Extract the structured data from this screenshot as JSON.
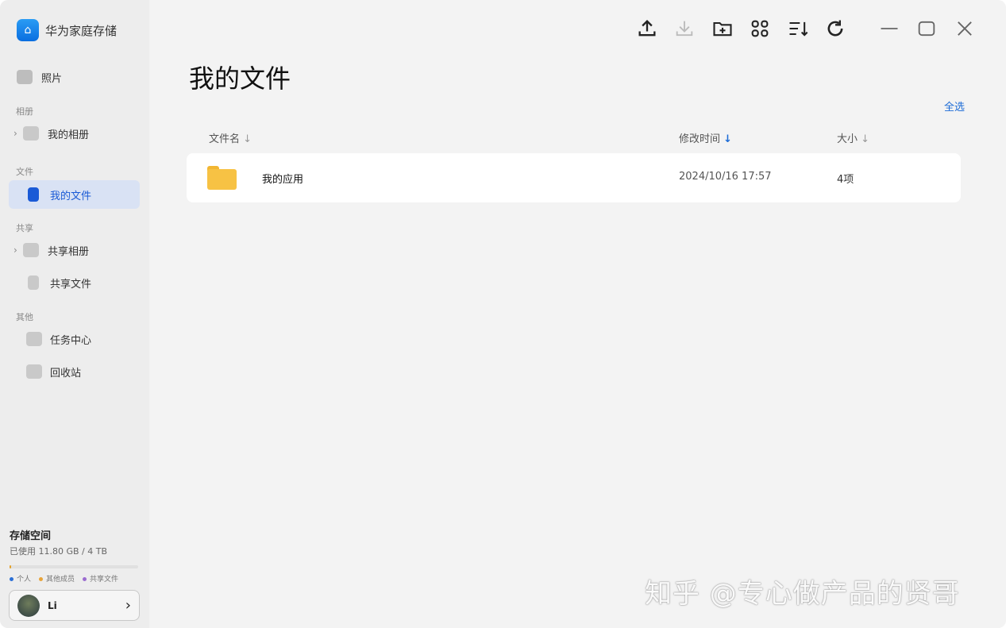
{
  "app": {
    "title": "华为家庭存储"
  },
  "sidebar": {
    "photos": "照片",
    "sections": {
      "albums": "相册",
      "files": "文件",
      "shared": "共享",
      "other": "其他"
    },
    "items": {
      "my_albums": "我的相册",
      "my_files": "我的文件",
      "shared_albums": "共享相册",
      "shared_files": "共享文件",
      "task_center": "任务中心",
      "recycle_bin": "回收站"
    },
    "storage": {
      "title": "存储空间",
      "usage": "已使用 11.80 GB / 4 TB",
      "used_fraction": 0.003,
      "legend": [
        {
          "label": "个人",
          "color": "#2b6fd6"
        },
        {
          "label": "其他成员",
          "color": "#e8a43a"
        },
        {
          "label": "共享文件",
          "color": "#9b6cd0"
        }
      ]
    },
    "user": {
      "name": "Li"
    }
  },
  "toolbar": {
    "icons": [
      "upload-icon",
      "download-icon",
      "new-folder-icon",
      "grid-view-icon",
      "sort-icon",
      "refresh-icon"
    ]
  },
  "main": {
    "title": "我的文件",
    "select_all": "全选",
    "columns": {
      "name": "文件名",
      "modified": "修改时间",
      "size": "大小"
    },
    "rows": [
      {
        "name": "我的应用",
        "modified": "2024/10/16 17:57",
        "size": "4项"
      }
    ]
  },
  "accent": "#1a6ad6",
  "watermark": "知乎 @专心做产品的贤哥"
}
